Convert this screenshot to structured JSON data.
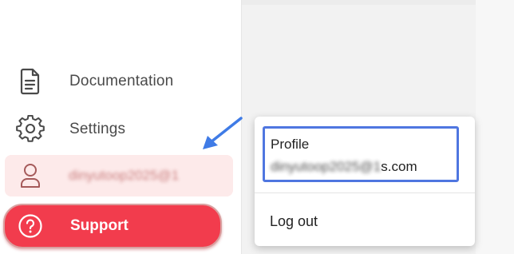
{
  "sidebar": {
    "items": [
      {
        "label": "Documentation",
        "icon": "document-icon"
      },
      {
        "label": "Settings",
        "icon": "gear-icon"
      }
    ],
    "account": {
      "label": "dinyutoop2025@1",
      "icon": "user-icon",
      "redacted": true
    },
    "support": {
      "label": "Support",
      "icon": "help-circle-icon"
    }
  },
  "popup": {
    "profile_title": "Profile",
    "email_redacted": "dinyutoop2025@1",
    "email_visible": "s.com",
    "logout_label": "Log out"
  },
  "colors": {
    "accent": "#f23c4d",
    "account_bg": "#fdeaea",
    "highlight_border": "#4f76e0",
    "text": "#4a4a4a",
    "annotation_arrow": "#3f7be6"
  }
}
